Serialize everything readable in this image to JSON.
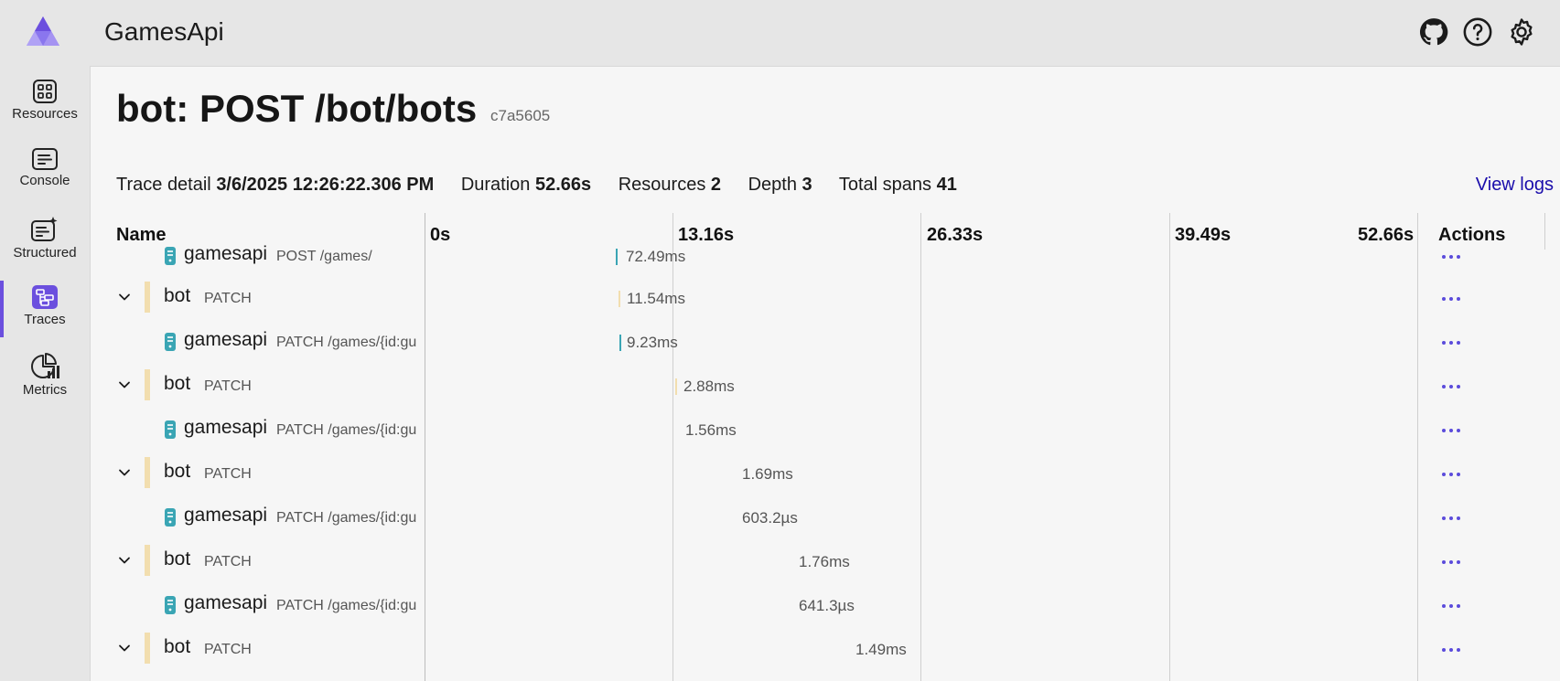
{
  "header": {
    "app_title": "GamesApi",
    "icons": [
      "github-icon",
      "help-icon",
      "settings-icon"
    ]
  },
  "sidebar": {
    "items": [
      {
        "label": "Resources",
        "icon": "resources-icon",
        "active": false
      },
      {
        "label": "Console",
        "icon": "console-icon",
        "active": false
      },
      {
        "label": "Structured",
        "icon": "structured-icon",
        "active": false
      },
      {
        "label": "Traces",
        "icon": "traces-icon",
        "active": true
      },
      {
        "label": "Metrics",
        "icon": "metrics-icon",
        "active": false
      }
    ]
  },
  "page": {
    "title": "bot: POST /bot/bots",
    "trace_id": "c7a5605",
    "view_logs": "View logs"
  },
  "summary": {
    "trace_detail_label": "Trace detail",
    "trace_detail_value": "3/6/2025 12:26:22.306 PM",
    "duration_label": "Duration",
    "duration_value": "52.66s",
    "resources_label": "Resources",
    "resources_value": "2",
    "depth_label": "Depth",
    "depth_value": "3",
    "total_spans_label": "Total spans",
    "total_spans_value": "41"
  },
  "grid": {
    "name_header": "Name",
    "actions_header": "Actions",
    "timeline_ticks": [
      "0s",
      "13.16s",
      "26.33s",
      "39.49s",
      "52.66s"
    ]
  },
  "rows": [
    {
      "service": "gamesapi",
      "operation": "POST /games/",
      "duration": "72.49ms",
      "expandable": false,
      "kind": "gamesapi"
    },
    {
      "service": "bot",
      "operation": "PATCH",
      "duration": "11.54ms",
      "expandable": true,
      "kind": "bot"
    },
    {
      "service": "gamesapi",
      "operation": "PATCH /games/{id:gu",
      "duration": "9.23ms",
      "expandable": false,
      "kind": "gamesapi"
    },
    {
      "service": "bot",
      "operation": "PATCH",
      "duration": "2.88ms",
      "expandable": true,
      "kind": "bot"
    },
    {
      "service": "gamesapi",
      "operation": "PATCH /games/{id:gu",
      "duration": "1.56ms",
      "expandable": false,
      "kind": "gamesapi"
    },
    {
      "service": "bot",
      "operation": "PATCH",
      "duration": "1.69ms",
      "expandable": true,
      "kind": "bot"
    },
    {
      "service": "gamesapi",
      "operation": "PATCH /games/{id:gu",
      "duration": "603.2µs",
      "expandable": false,
      "kind": "gamesapi"
    },
    {
      "service": "bot",
      "operation": "PATCH",
      "duration": "1.76ms",
      "expandable": true,
      "kind": "bot"
    },
    {
      "service": "gamesapi",
      "operation": "PATCH /games/{id:gu",
      "duration": "641.3µs",
      "expandable": false,
      "kind": "gamesapi"
    },
    {
      "service": "bot",
      "operation": "PATCH",
      "duration": "1.49ms",
      "expandable": true,
      "kind": "bot"
    }
  ],
  "colors": {
    "accent": "#6b4fde",
    "bot": "#f2deaf",
    "gamesapi": "#3aa5b4",
    "link": "#1a0dab"
  }
}
